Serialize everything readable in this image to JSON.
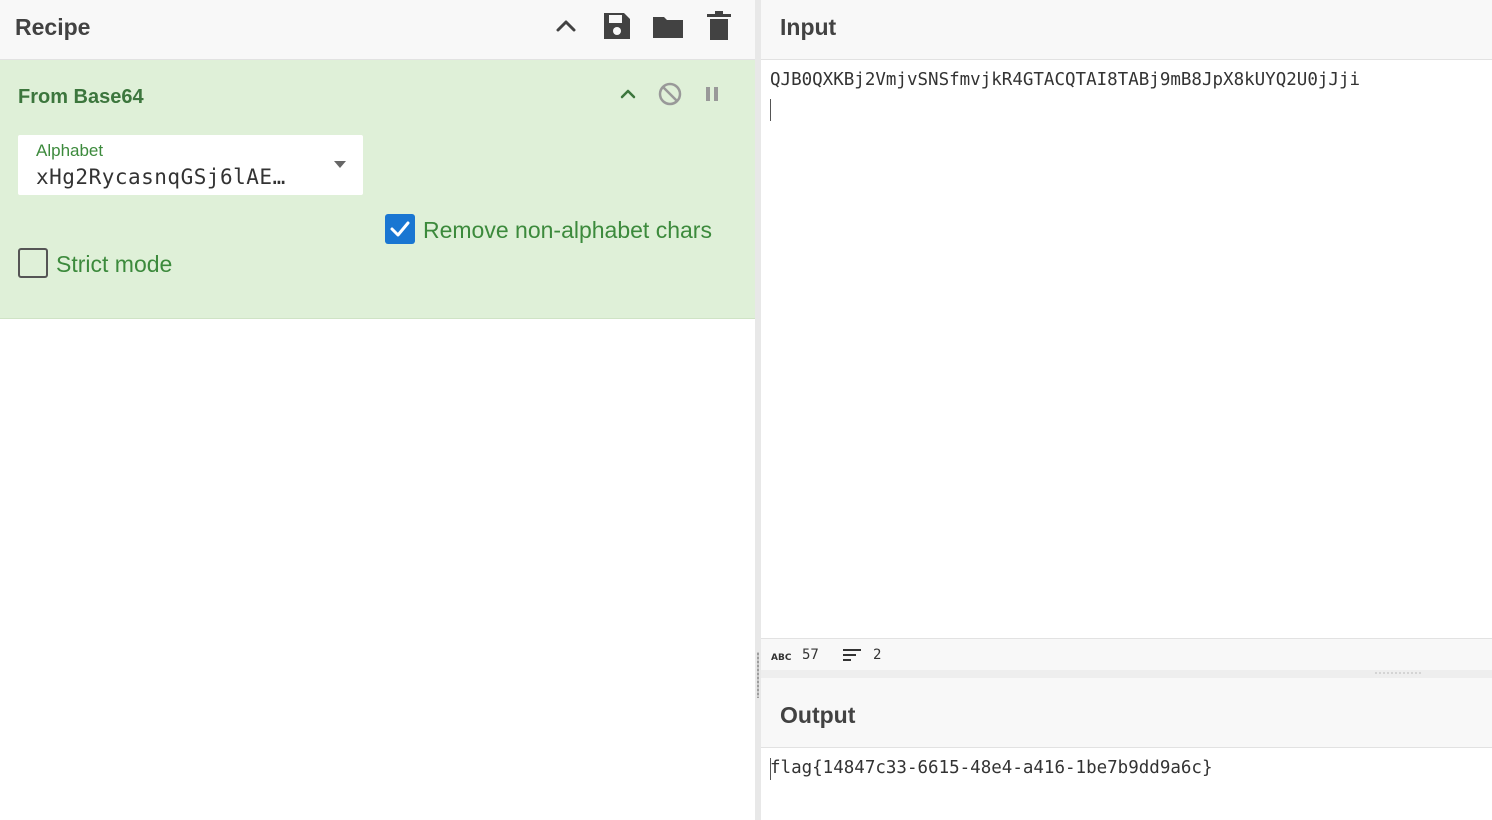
{
  "recipe": {
    "title": "Recipe",
    "toolbar": {
      "collapse_icon": "chevron-up-icon",
      "save_icon": "save-icon",
      "load_icon": "folder-icon",
      "clear_icon": "trash-icon"
    },
    "operation": {
      "title": "From Base64",
      "controls": [
        "chevron-up-icon",
        "disable-icon",
        "pause-icon"
      ],
      "alphabet_label": "Alphabet",
      "alphabet_value": "xHg2RycasnqGSj6lAE…",
      "remove_non_alphabet": {
        "label": "Remove non-alphabet chars",
        "checked": true
      },
      "strict_mode": {
        "label": "Strict mode",
        "checked": false
      },
      "accent_color": "#3c763d",
      "background_color": "#dff0d8"
    }
  },
  "input": {
    "title": "Input",
    "text": "QJB0QXKBj2VmjvSNSfmvjkR4GTACQTAI8TABj9mB8JpX8kUYQ2U0jJji",
    "stats": {
      "chars_icon": "abc-icon",
      "chars": "57",
      "lines_icon": "lines-icon",
      "lines": "2"
    }
  },
  "output": {
    "title": "Output",
    "text": "flag{14847c33-6615-48e4-a416-1be7b9dd9a6c}"
  },
  "colors": {
    "checkbox": "#1976d2",
    "header_bg": "#f8f8f8"
  }
}
